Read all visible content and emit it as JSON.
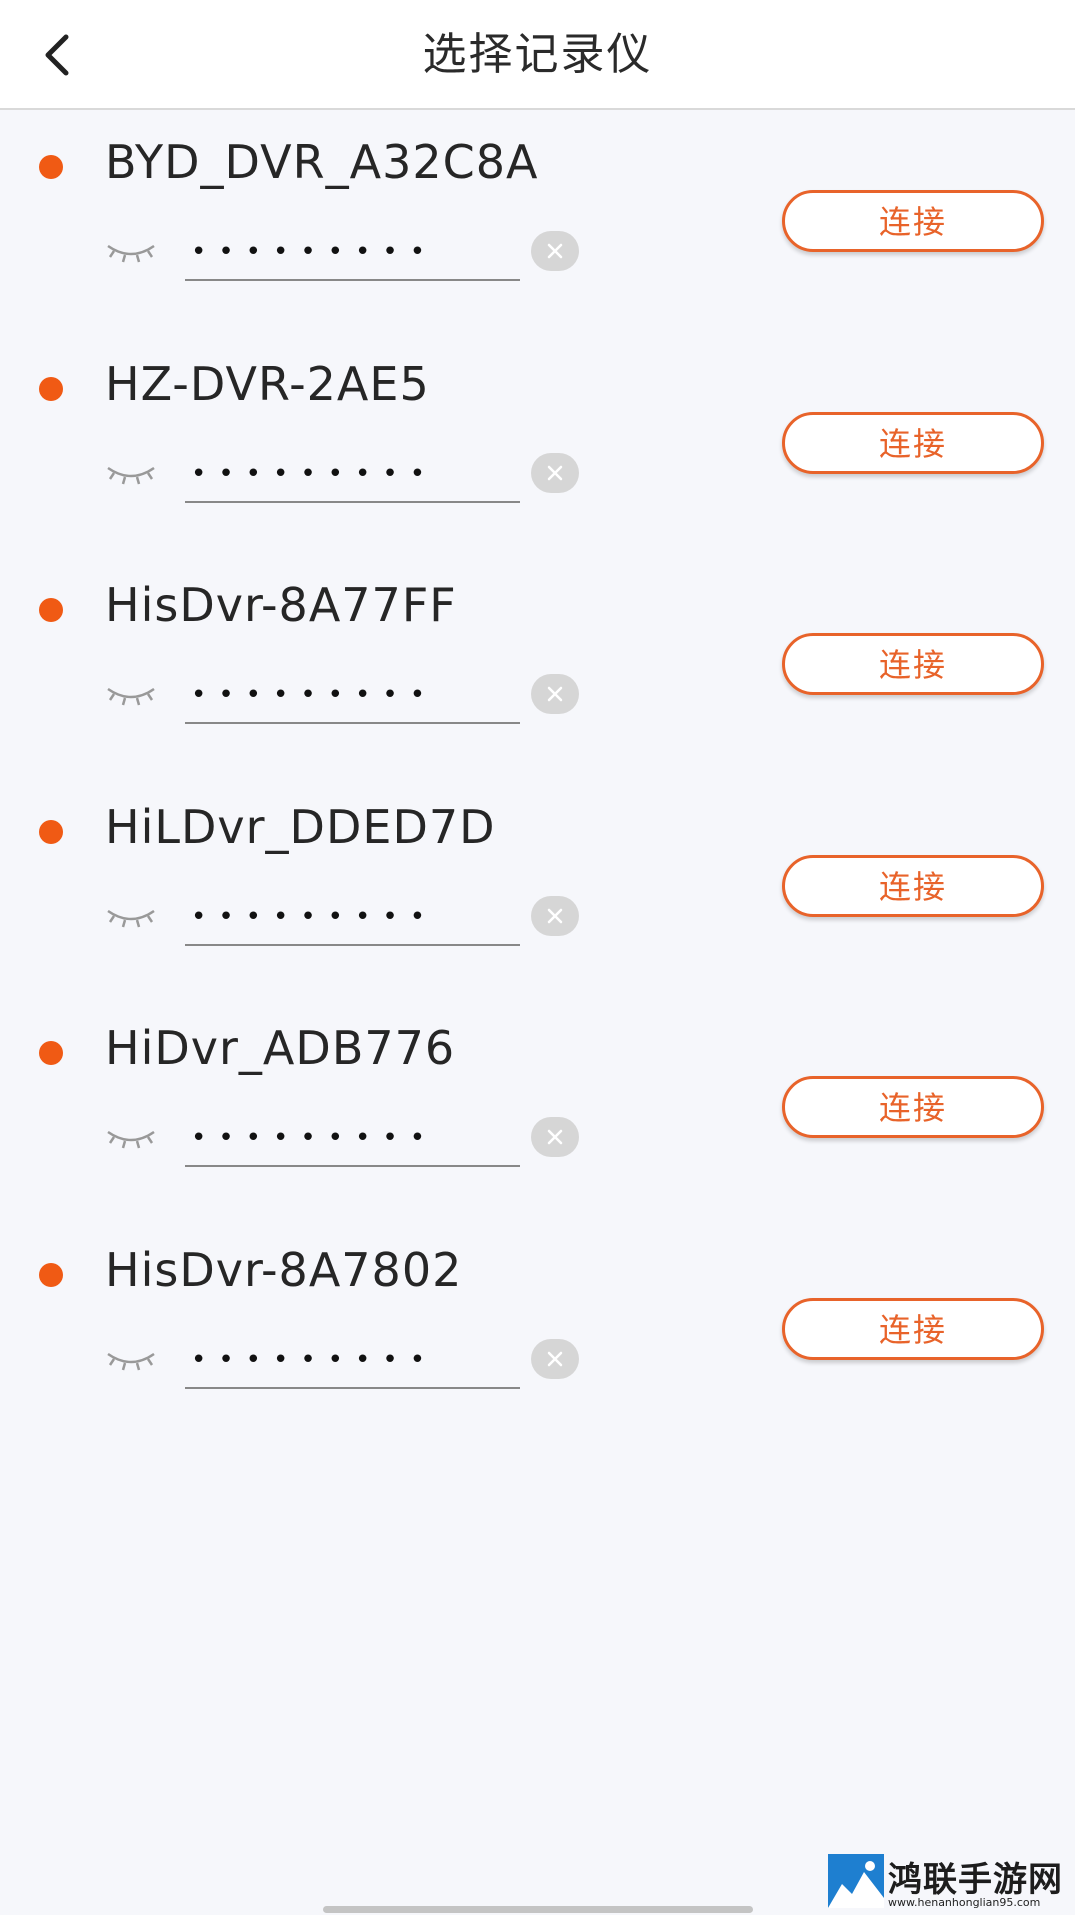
{
  "header": {
    "title": "选择记录仪",
    "back_icon": "chevron-left-icon"
  },
  "devices": [
    {
      "name": "BYD_DVR_A32C8A",
      "password": "•••••••••",
      "connect_label": "连接"
    },
    {
      "name": "HZ-DVR-2AE5",
      "password": "•••••••••",
      "connect_label": "连接"
    },
    {
      "name": "HisDvr-8A77FF",
      "password": "•••••••••",
      "connect_label": "连接"
    },
    {
      "name": "HiLDvr_DDED7D",
      "password": "•••••••••",
      "connect_label": "连接"
    },
    {
      "name": "HiDvr_ADB776",
      "password": "•••••••••",
      "connect_label": "连接"
    },
    {
      "name": "HisDvr-8A7802",
      "password": "•••••••••",
      "connect_label": "连接"
    }
  ],
  "colors": {
    "accent": "#e8632a",
    "dot": "#f05a14",
    "background": "#f6f7fb"
  },
  "watermark": {
    "title": "鸿联手游网",
    "url": "www.henanhonglian95.com"
  }
}
